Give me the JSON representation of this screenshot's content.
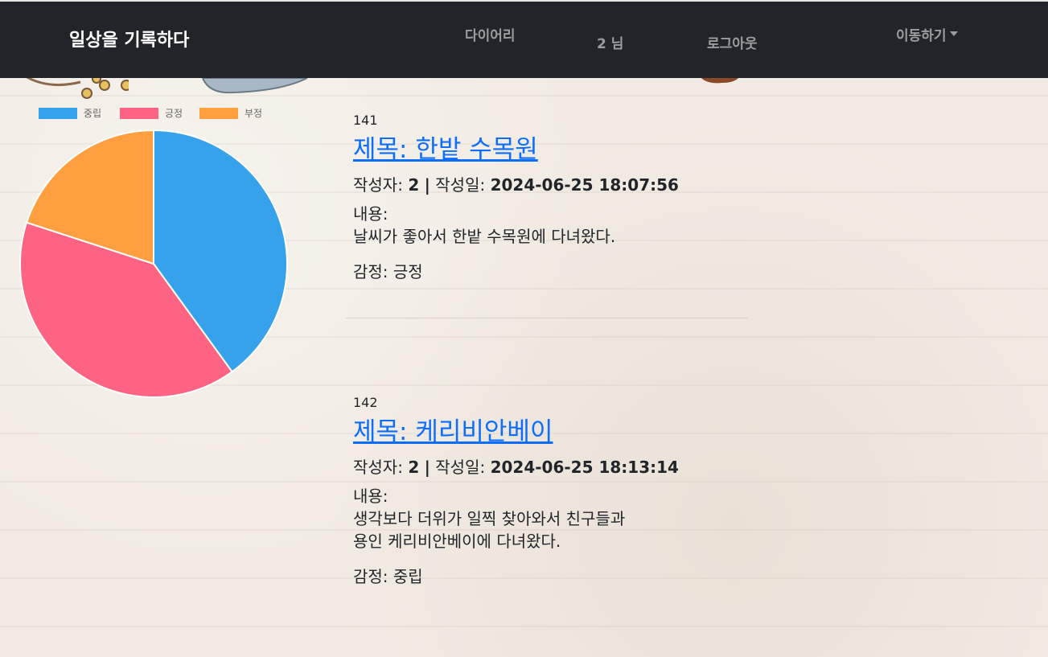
{
  "navbar": {
    "brand": "일상을 기록하다",
    "links": {
      "diary": "다이어리",
      "user": "2 님",
      "logout": "로그아웃",
      "move": "이동하기"
    }
  },
  "colors": {
    "navbar_bg": "#212529",
    "link": "#0d6efd",
    "neutral": "#36a2eb",
    "positive": "#ff6384",
    "negative": "#ff9f40"
  },
  "chart_data": {
    "type": "pie",
    "legend_position": "top",
    "categories": [
      "중립",
      "긍정",
      "부정"
    ],
    "values": [
      40,
      40,
      20
    ],
    "colors": [
      "#36a2eb",
      "#ff6384",
      "#ff9f40"
    ]
  },
  "posts": [
    {
      "id": "141",
      "title": "제목: 한밭 수목원",
      "author_label": "작성자:",
      "author": "2",
      "separator": "|",
      "date_label": "작성일:",
      "date": "2024-06-25 18:07:56",
      "content_label": "내용:",
      "content": "날씨가 좋아서 한밭 수목원에 다녀왔다.",
      "emotion": "감정: 긍정"
    },
    {
      "id": "142",
      "title": "제목: 케리비안베이",
      "author_label": "작성자:",
      "author": "2",
      "separator": "|",
      "date_label": "작성일:",
      "date": "2024-06-25 18:13:14",
      "content_label": "내용:",
      "content": "생각보다 더위가 일찍 찾아와서 친구들과\n용인 케리비안베이에 다녀왔다.",
      "emotion": "감정: 중립"
    }
  ]
}
